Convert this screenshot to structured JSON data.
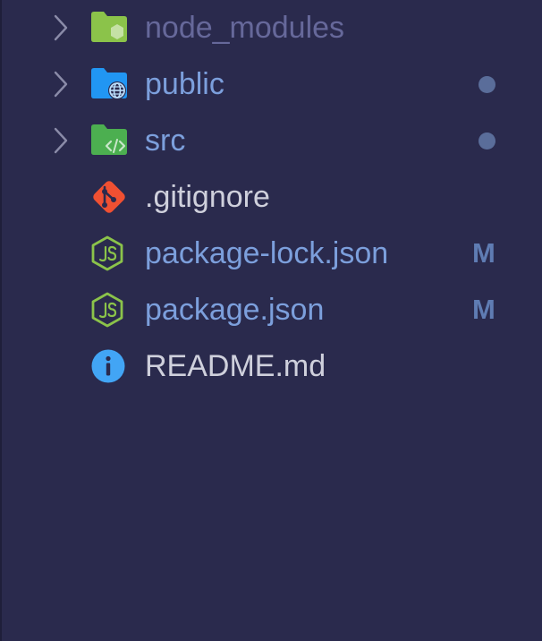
{
  "colors": {
    "background": "#2a2a4d",
    "ignored_text": "#66689a",
    "modified_text": "#7c9fdc",
    "default_text": "#cfd0dc",
    "chevron": "#8a8ba8",
    "dot": "#5a6d9a",
    "badge": "#5f7cb3"
  },
  "explorer": {
    "items": [
      {
        "label": "node_modules",
        "type": "folder",
        "icon": "node-modules-folder-icon",
        "status": "ignored"
      },
      {
        "label": "public",
        "type": "folder",
        "icon": "public-folder-icon",
        "status": "modified-dot"
      },
      {
        "label": "src",
        "type": "folder",
        "icon": "src-folder-icon",
        "status": "modified-dot"
      },
      {
        "label": ".gitignore",
        "type": "file",
        "icon": "git-icon",
        "status": "none"
      },
      {
        "label": "package-lock.json",
        "type": "file",
        "icon": "nodejs-icon",
        "status": "modified",
        "badge": "M"
      },
      {
        "label": "package.json",
        "type": "file",
        "icon": "nodejs-icon",
        "status": "modified",
        "badge": "M"
      },
      {
        "label": "README.md",
        "type": "file",
        "icon": "info-icon",
        "status": "none"
      }
    ]
  }
}
